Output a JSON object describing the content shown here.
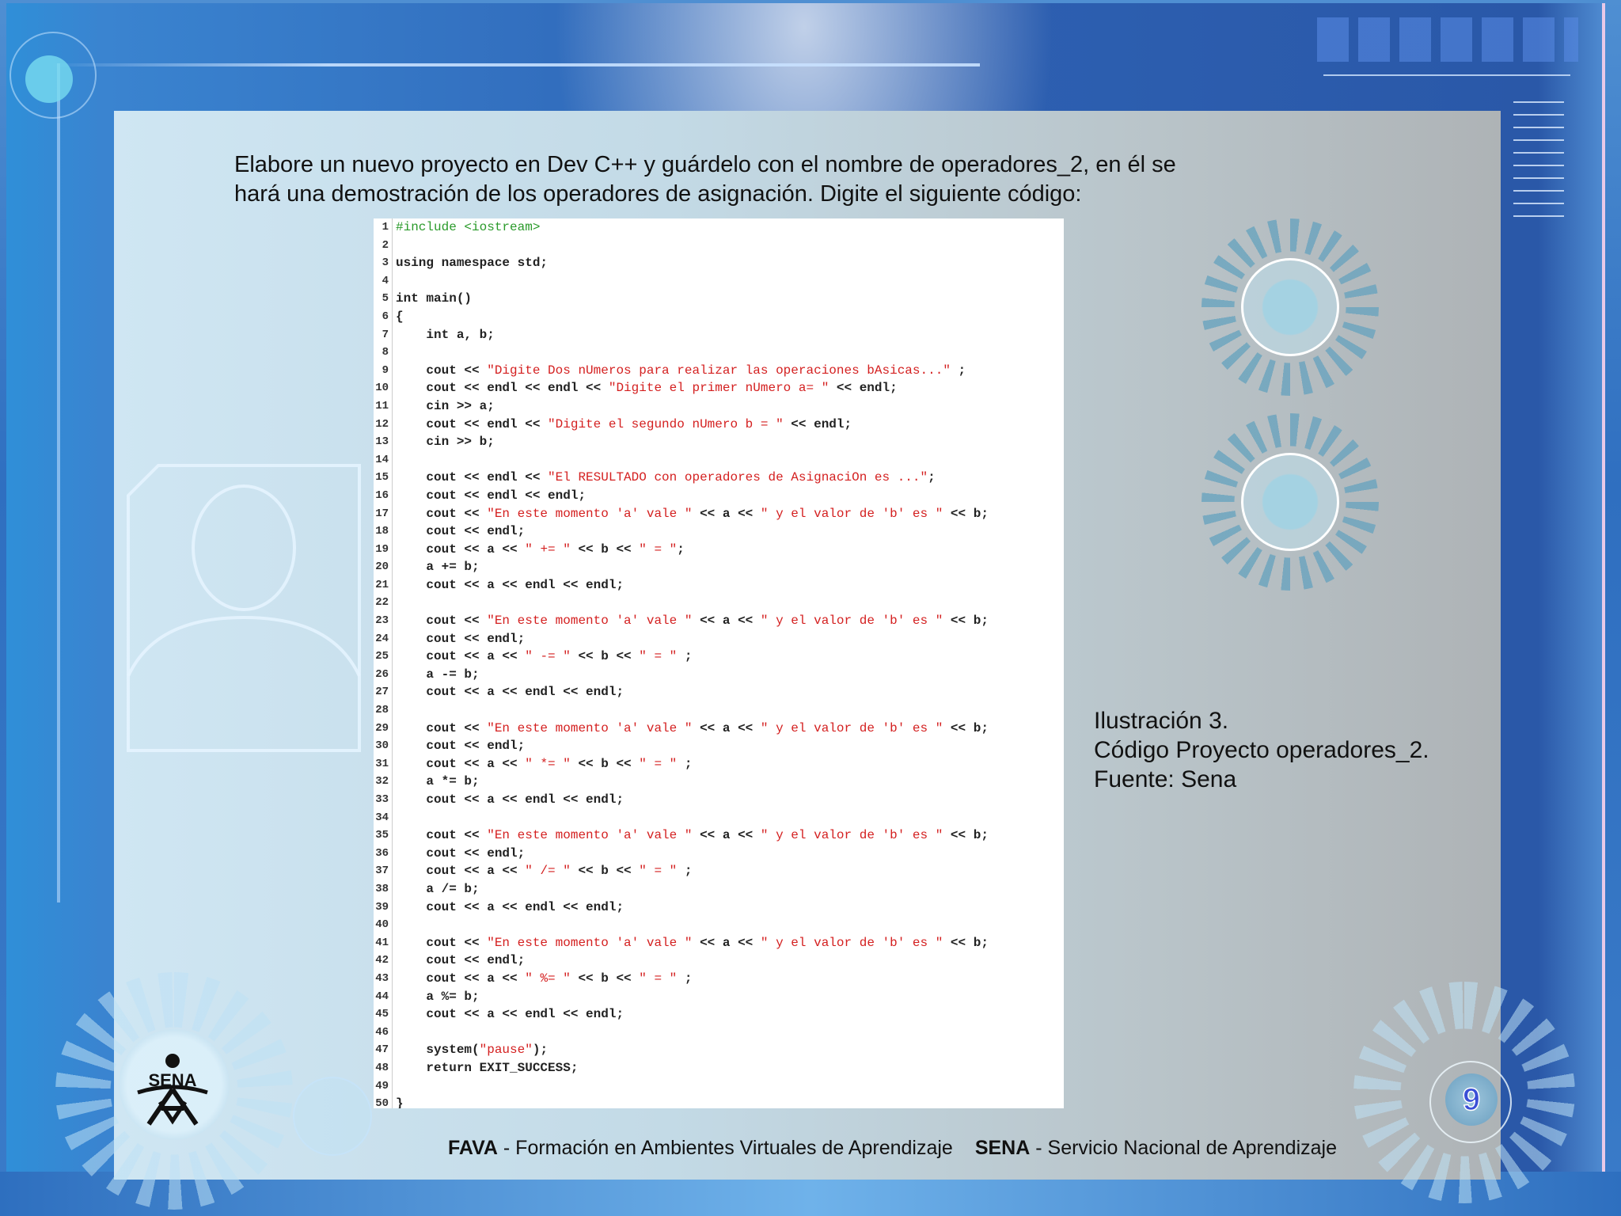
{
  "intro_line1": "Elabore un nuevo proyecto en Dev C++ y guárdelo con el nombre de operadores_2, en él se",
  "intro_line2": "hará una demostración de los operadores de asignación. Digite el siguiente código:",
  "code": {
    "lines": [
      {
        "n": "1",
        "parts": [
          {
            "t": "#include <iostream>",
            "c": "pp"
          }
        ]
      },
      {
        "n": "2",
        "parts": []
      },
      {
        "n": "3",
        "parts": [
          {
            "t": "using namespace std;",
            "c": ""
          }
        ]
      },
      {
        "n": "4",
        "parts": []
      },
      {
        "n": "5",
        "parts": [
          {
            "t": "int main()",
            "c": ""
          }
        ]
      },
      {
        "n": "6",
        "parts": [
          {
            "t": "{",
            "c": ""
          }
        ]
      },
      {
        "n": "7",
        "parts": [
          {
            "t": "    int a, b;",
            "c": ""
          }
        ]
      },
      {
        "n": "8",
        "parts": []
      },
      {
        "n": "9",
        "parts": [
          {
            "t": "    cout << ",
            "c": ""
          },
          {
            "t": "\"Digite Dos nUmeros para realizar las operaciones bAsicas...\"",
            "c": "str"
          },
          {
            "t": " ;",
            "c": ""
          }
        ]
      },
      {
        "n": "10",
        "parts": [
          {
            "t": "    cout << endl << endl << ",
            "c": ""
          },
          {
            "t": "\"Digite el primer nUmero a= \"",
            "c": "str"
          },
          {
            "t": " << endl;",
            "c": ""
          }
        ]
      },
      {
        "n": "11",
        "parts": [
          {
            "t": "    cin >> a;",
            "c": ""
          }
        ]
      },
      {
        "n": "12",
        "parts": [
          {
            "t": "    cout << endl << ",
            "c": ""
          },
          {
            "t": "\"Digite el segundo nUmero b = \"",
            "c": "str"
          },
          {
            "t": " << endl;",
            "c": ""
          }
        ]
      },
      {
        "n": "13",
        "parts": [
          {
            "t": "    cin >> b;",
            "c": ""
          }
        ]
      },
      {
        "n": "14",
        "parts": []
      },
      {
        "n": "15",
        "parts": [
          {
            "t": "    cout << endl << ",
            "c": ""
          },
          {
            "t": "\"El RESULTADO con operadores de AsignaciOn es ...\"",
            "c": "str"
          },
          {
            "t": ";",
            "c": ""
          }
        ]
      },
      {
        "n": "16",
        "parts": [
          {
            "t": "    cout << endl << endl;",
            "c": ""
          }
        ]
      },
      {
        "n": "17",
        "parts": [
          {
            "t": "    cout << ",
            "c": ""
          },
          {
            "t": "\"En este momento 'a' vale \"",
            "c": "str"
          },
          {
            "t": " << a << ",
            "c": ""
          },
          {
            "t": "\" y el valor de 'b' es \"",
            "c": "str"
          },
          {
            "t": " << b;",
            "c": ""
          }
        ]
      },
      {
        "n": "18",
        "parts": [
          {
            "t": "    cout << endl;",
            "c": ""
          }
        ]
      },
      {
        "n": "19",
        "parts": [
          {
            "t": "    cout << a << ",
            "c": ""
          },
          {
            "t": "\" += \"",
            "c": "str"
          },
          {
            "t": " << b << ",
            "c": ""
          },
          {
            "t": "\" = \"",
            "c": "str"
          },
          {
            "t": ";",
            "c": ""
          }
        ]
      },
      {
        "n": "20",
        "parts": [
          {
            "t": "    a += b;",
            "c": ""
          }
        ]
      },
      {
        "n": "21",
        "parts": [
          {
            "t": "    cout << a << endl << endl;",
            "c": ""
          }
        ]
      },
      {
        "n": "22",
        "parts": []
      },
      {
        "n": "23",
        "parts": [
          {
            "t": "    cout << ",
            "c": ""
          },
          {
            "t": "\"En este momento 'a' vale \"",
            "c": "str"
          },
          {
            "t": " << a << ",
            "c": ""
          },
          {
            "t": "\" y el valor de 'b' es \"",
            "c": "str"
          },
          {
            "t": " << b;",
            "c": ""
          }
        ]
      },
      {
        "n": "24",
        "parts": [
          {
            "t": "    cout << endl;",
            "c": ""
          }
        ]
      },
      {
        "n": "25",
        "parts": [
          {
            "t": "    cout << a << ",
            "c": ""
          },
          {
            "t": "\" -= \"",
            "c": "str"
          },
          {
            "t": " << b << ",
            "c": ""
          },
          {
            "t": "\" = \"",
            "c": "str"
          },
          {
            "t": " ;",
            "c": ""
          }
        ]
      },
      {
        "n": "26",
        "parts": [
          {
            "t": "    a -= b;",
            "c": ""
          }
        ]
      },
      {
        "n": "27",
        "parts": [
          {
            "t": "    cout << a << endl << endl;",
            "c": ""
          }
        ]
      },
      {
        "n": "28",
        "parts": []
      },
      {
        "n": "29",
        "parts": [
          {
            "t": "    cout << ",
            "c": ""
          },
          {
            "t": "\"En este momento 'a' vale \"",
            "c": "str"
          },
          {
            "t": " << a << ",
            "c": ""
          },
          {
            "t": "\" y el valor de 'b' es \"",
            "c": "str"
          },
          {
            "t": " << b;",
            "c": ""
          }
        ]
      },
      {
        "n": "30",
        "parts": [
          {
            "t": "    cout << endl;",
            "c": ""
          }
        ]
      },
      {
        "n": "31",
        "parts": [
          {
            "t": "    cout << a << ",
            "c": ""
          },
          {
            "t": "\" *= \"",
            "c": "str"
          },
          {
            "t": " << b << ",
            "c": ""
          },
          {
            "t": "\" = \"",
            "c": "str"
          },
          {
            "t": " ;",
            "c": ""
          }
        ]
      },
      {
        "n": "32",
        "parts": [
          {
            "t": "    a *= b;",
            "c": ""
          }
        ]
      },
      {
        "n": "33",
        "parts": [
          {
            "t": "    cout << a << endl << endl;",
            "c": ""
          }
        ]
      },
      {
        "n": "34",
        "parts": []
      },
      {
        "n": "35",
        "parts": [
          {
            "t": "    cout << ",
            "c": ""
          },
          {
            "t": "\"En este momento 'a' vale \"",
            "c": "str"
          },
          {
            "t": " << a << ",
            "c": ""
          },
          {
            "t": "\" y el valor de 'b' es \"",
            "c": "str"
          },
          {
            "t": " << b;",
            "c": ""
          }
        ]
      },
      {
        "n": "36",
        "parts": [
          {
            "t": "    cout << endl;",
            "c": ""
          }
        ]
      },
      {
        "n": "37",
        "parts": [
          {
            "t": "    cout << a << ",
            "c": ""
          },
          {
            "t": "\" /= \"",
            "c": "str"
          },
          {
            "t": " << b << ",
            "c": ""
          },
          {
            "t": "\" = \"",
            "c": "str"
          },
          {
            "t": " ;",
            "c": ""
          }
        ]
      },
      {
        "n": "38",
        "parts": [
          {
            "t": "    a /= b;",
            "c": ""
          }
        ]
      },
      {
        "n": "39",
        "parts": [
          {
            "t": "    cout << a << endl << endl;",
            "c": ""
          }
        ]
      },
      {
        "n": "40",
        "parts": []
      },
      {
        "n": "41",
        "parts": [
          {
            "t": "    cout << ",
            "c": ""
          },
          {
            "t": "\"En este momento 'a' vale \"",
            "c": "str"
          },
          {
            "t": " << a << ",
            "c": ""
          },
          {
            "t": "\" y el valor de 'b' es \"",
            "c": "str"
          },
          {
            "t": " << b;",
            "c": ""
          }
        ]
      },
      {
        "n": "42",
        "parts": [
          {
            "t": "    cout << endl;",
            "c": ""
          }
        ]
      },
      {
        "n": "43",
        "parts": [
          {
            "t": "    cout << a << ",
            "c": ""
          },
          {
            "t": "\" %= \"",
            "c": "str"
          },
          {
            "t": " << b << ",
            "c": ""
          },
          {
            "t": "\" = \"",
            "c": "str"
          },
          {
            "t": " ;",
            "c": ""
          }
        ]
      },
      {
        "n": "44",
        "parts": [
          {
            "t": "    a %= b;",
            "c": ""
          }
        ]
      },
      {
        "n": "45",
        "parts": [
          {
            "t": "    cout << a << endl << endl;",
            "c": ""
          }
        ]
      },
      {
        "n": "46",
        "parts": []
      },
      {
        "n": "47",
        "parts": [
          {
            "t": "    system(",
            "c": ""
          },
          {
            "t": "\"pause\"",
            "c": "str"
          },
          {
            "t": ");",
            "c": ""
          }
        ]
      },
      {
        "n": "48",
        "parts": [
          {
            "t": "    return EXIT_SUCCESS;",
            "c": ""
          }
        ]
      },
      {
        "n": "49",
        "parts": []
      },
      {
        "n": "50",
        "parts": [
          {
            "t": "}",
            "c": ""
          }
        ]
      }
    ]
  },
  "caption": {
    "line1": "Ilustración 3.",
    "line2": "Código Proyecto operadores_2.",
    "line3": "Fuente: Sena"
  },
  "logo_text": "SENA",
  "page_number": "9",
  "footer": {
    "fava_bold": "FAVA",
    "fava_rest": " - Formación en Ambientes Virtuales de Aprendizaje",
    "sena_bold": "SENA",
    "sena_rest": " - Servicio Nacional de Aprendizaje"
  },
  "colors": {
    "code_string": "#d42020",
    "code_preprocessor": "#2a9a2a",
    "page_number": "#3a4fd6"
  },
  "icons": [
    "user-silhouette-icon",
    "gear-decoration-icon",
    "sena-logo-icon"
  ]
}
